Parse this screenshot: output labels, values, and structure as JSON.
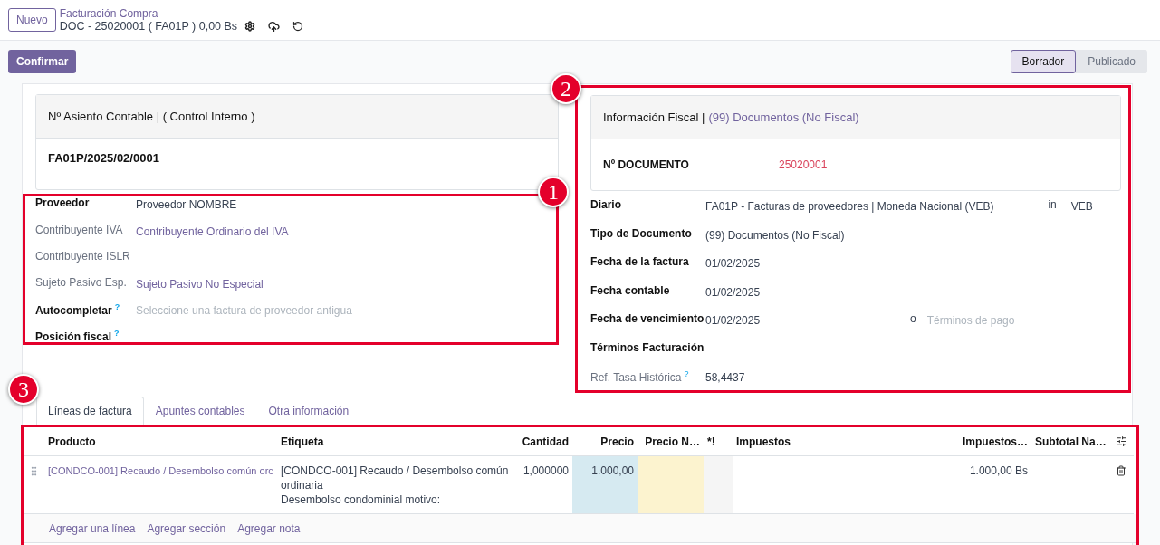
{
  "top": {
    "new_button": "Nuevo",
    "breadcrumb": "Facturación Compra",
    "record": "DOC - 25020001 ( FA01P ) 0,00 Bs"
  },
  "actions": {
    "confirm": "Confirmar"
  },
  "status_steps": [
    {
      "label": "Borrador",
      "selected": true
    },
    {
      "label": "Publicado",
      "selected": false
    }
  ],
  "accounting_entry": {
    "title": "Nº Asiento Contable | ( Control Interno )",
    "value": "FA01P/2025/02/0001"
  },
  "partner_fields": [
    {
      "label": "Proveedor",
      "muted": false,
      "kind": "text",
      "value": "Proveedor NOMBRE"
    },
    {
      "label": "Contribuyente IVA",
      "muted": true,
      "kind": "link",
      "value": "Contribuyente Ordinario del IVA"
    },
    {
      "label": "Contribuyente ISLR",
      "muted": true,
      "kind": "none"
    },
    {
      "label": "Sujeto Pasivo Esp.",
      "muted": true,
      "kind": "link",
      "value": "Sujeto Pasivo No Especial"
    },
    {
      "label": "Autocompletar",
      "muted": false,
      "help": "?",
      "kind": "input",
      "placeholder": "Seleccione una factura de proveedor antigua"
    },
    {
      "label": "Posición fiscal",
      "muted": false,
      "help": "?",
      "kind": "none"
    }
  ],
  "fiscal_info": {
    "title": "Información Fiscal |",
    "document_type": "(99) Documentos (No Fiscal)",
    "doc_label": "Nº DOCUMENTO",
    "doc_value": "25020001"
  },
  "invoice_fields": [
    {
      "label": "Diario",
      "muted": false,
      "kind": "text",
      "value": "FA01P - Facturas de proveedores | Moneda Nacional (VEB)",
      "separator": "in",
      "extra": "VEB"
    },
    {
      "label": "Tipo de Documento",
      "muted": false,
      "kind": "text",
      "value": "(99) Documentos (No Fiscal)"
    },
    {
      "label": "Fecha de la factura",
      "muted": false,
      "kind": "text",
      "value": "01/02/2025"
    },
    {
      "label": "Fecha contable",
      "muted": false,
      "kind": "text",
      "value": "01/02/2025"
    },
    {
      "label": "Fecha de vencimiento",
      "muted": false,
      "kind": "text",
      "value": "01/02/2025",
      "separator": "o",
      "extra_placeholder": "Términos de pago"
    },
    {
      "label": "Términos Facturación",
      "muted": false,
      "kind": "none"
    },
    {
      "label": "Ref. Tasa Histórica",
      "muted": true,
      "help": "?",
      "kind": "text",
      "value": "58,4437"
    }
  ],
  "annotations": [
    "1",
    "2",
    "3"
  ],
  "tabs": [
    {
      "label": "Líneas de factura",
      "selected": true
    },
    {
      "label": "Apuntes contables",
      "selected": false
    },
    {
      "label": "Otra información",
      "selected": false
    }
  ],
  "table": {
    "columns": [
      "Producto",
      "Etiqueta",
      "Cantidad",
      "Precio",
      "Precio N…",
      "*!",
      "Impuestos",
      "Impuestos…",
      "Subtotal Na…"
    ],
    "rows": [
      {
        "product": "[CONDCO-001] Recaudo / Desembolso común orc",
        "label_lines": [
          "[CONDCO-001] Recaudo / Desembolso común ordinaria",
          "Desembolso condominial motivo:"
        ],
        "quantity": "1,000000",
        "price": "1.000,00",
        "tax_amount": "1.000,00 Bs"
      }
    ],
    "add_links": [
      "Agregar una línea",
      "Agregar sección",
      "Agregar nota"
    ]
  }
}
